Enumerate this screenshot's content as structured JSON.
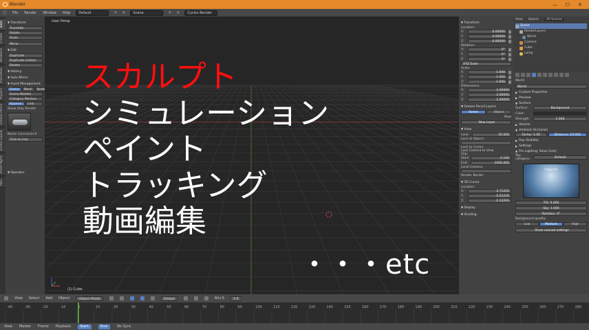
{
  "window": {
    "app": "Blender",
    "controls": [
      "—",
      "☐",
      "✕"
    ]
  },
  "menubar": {
    "items": [
      "File",
      "Render",
      "Window",
      "Help"
    ],
    "layout": "Default",
    "scene": "Scene",
    "engine": "Cycles Render"
  },
  "left_tabs": [
    "Tools",
    "Create",
    "Relations",
    "Animation",
    "Physics",
    "Grease Pencil",
    "Scene Layout",
    "Asset Mgmt",
    "Misc"
  ],
  "toolshelf": {
    "transform_header": "Transform",
    "transform_buttons": [
      "Translate",
      "Rotate",
      "Scale"
    ],
    "mirror": "Mirror",
    "edit_header": "Edit",
    "edit_buttons": [
      "Duplicate",
      "Duplicate Linked",
      "Delete"
    ],
    "history_header": "History",
    "auto_mirror": "Auto Mirror",
    "asset_header": "Asset Management",
    "asset_tabs": [
      "Scene",
      "Mesh",
      "Node",
      "Inst"
    ],
    "asset_rows": [
      "Scene  Models",
      "Category  Meshes"
    ],
    "asset_append": "Append",
    "asset_link": "Link",
    "show_only_render": "Show Only Render",
    "name_label": "Name",
    "name_value": "Connector.0",
    "click_btn": "Click to Imp",
    "operator": "Operator"
  },
  "viewport": {
    "label": "User Persp",
    "object": "(1) Cube"
  },
  "overlay": {
    "line1": "スカルプト",
    "line2": "シミュレーション",
    "line3": "ペイント",
    "line4": "トラッキング",
    "line5": "動画編集",
    "etc": "・・・etc"
  },
  "props": {
    "transform": "Transform",
    "location": "Location:",
    "loc": [
      "0.00000",
      "0.00000",
      "0.00000"
    ],
    "rotation": "Rotation:",
    "rot": [
      "0°",
      "0°",
      "0°"
    ],
    "rotmode": "XYZ Euler",
    "scale": "Scale:",
    "scl": [
      "1.000",
      "1.000",
      "1.000"
    ],
    "dimensions": "Dimensions:",
    "dim": [
      "2.00000",
      "2.00000",
      "2.00000"
    ],
    "grease": "Grease Pencil Layers",
    "grease_tabs": [
      "Scene",
      "Object"
    ],
    "new": "New",
    "new_layer": "New Layer",
    "view": "View",
    "lens": "Lens:",
    "lens_val": "35.000",
    "lock_obj": "Lock to Object:",
    "lock_cursor": "Lock to Cursor",
    "lock_cam": "Lock Camera to View",
    "clip": "Clip:",
    "clip_start": "Start:",
    "clip_start_val": "0.100",
    "clip_end": "End:",
    "clip_end_val": "1000.000",
    "local_camera": "Local Camera:",
    "render_border": "Render Border",
    "cursor": "3D Cursor",
    "cursor_loc": "Location:",
    "cur": [
      "2.71255",
      "-2.51226",
      "-2.12293"
    ],
    "display": "Display",
    "shading": "Shading",
    "axes": [
      "X:",
      "Y:",
      "Z:"
    ]
  },
  "outliner": {
    "tabs": [
      "View",
      "Search",
      "All Scenes"
    ],
    "rows": [
      "Scene",
      "RenderLayers",
      "World",
      "Camera",
      "Cube",
      "Lamp"
    ]
  },
  "world_props": {
    "name": "World",
    "world_label": "World",
    "sections": [
      "Custom Properties",
      "Preview",
      "Surface"
    ],
    "surface_label": "Surface:",
    "surface_val": "Background",
    "color_label": "Color:",
    "strength_label": "Strength:",
    "strength_val": "1.000",
    "volume": "Volume",
    "ao": "Ambient Occlusion",
    "factor": "Factor:",
    "factor_val": "1.00",
    "distance": "Distance:",
    "distance_val": "10.000",
    "ray": "Ray Visibility",
    "settings": "Settings",
    "probook": "Pro Lighting: Skies (Lite)",
    "category": "Sky category:",
    "category_val": "Default",
    "preview_name": "Clear 01",
    "tilt": "Tilt:",
    "tilt_val": "0.000",
    "sky": "Sky:",
    "sky_val": "1.000",
    "rotation": "Rotation:",
    "rotation_val": "0°",
    "quality": "Background quality:",
    "quality_tabs": [
      "Low",
      "Medium",
      "High"
    ],
    "show_more": "Show unused settings"
  },
  "vphdr": {
    "items": [
      "View",
      "Select",
      "Add",
      "Object"
    ],
    "mode": "Object Mode",
    "pivot": "Global",
    "snap": "Alt+S",
    "cfra": "3 E"
  },
  "timeline": {
    "ticks": [
      "-40",
      "-30",
      "-20",
      "-10",
      "0",
      "10",
      "20",
      "30",
      "40",
      "50",
      "60",
      "70",
      "80",
      "90",
      "100",
      "110",
      "120",
      "130",
      "140",
      "150",
      "160",
      "170",
      "180",
      "190",
      "200",
      "210",
      "220",
      "230",
      "240",
      "250",
      "260",
      "270",
      "280"
    ],
    "current": 1
  },
  "tlhdr": {
    "items": [
      "View",
      "Marker",
      "Frame",
      "Playback"
    ],
    "start": "Start:",
    "end": "End:",
    "sync": "No Sync"
  }
}
